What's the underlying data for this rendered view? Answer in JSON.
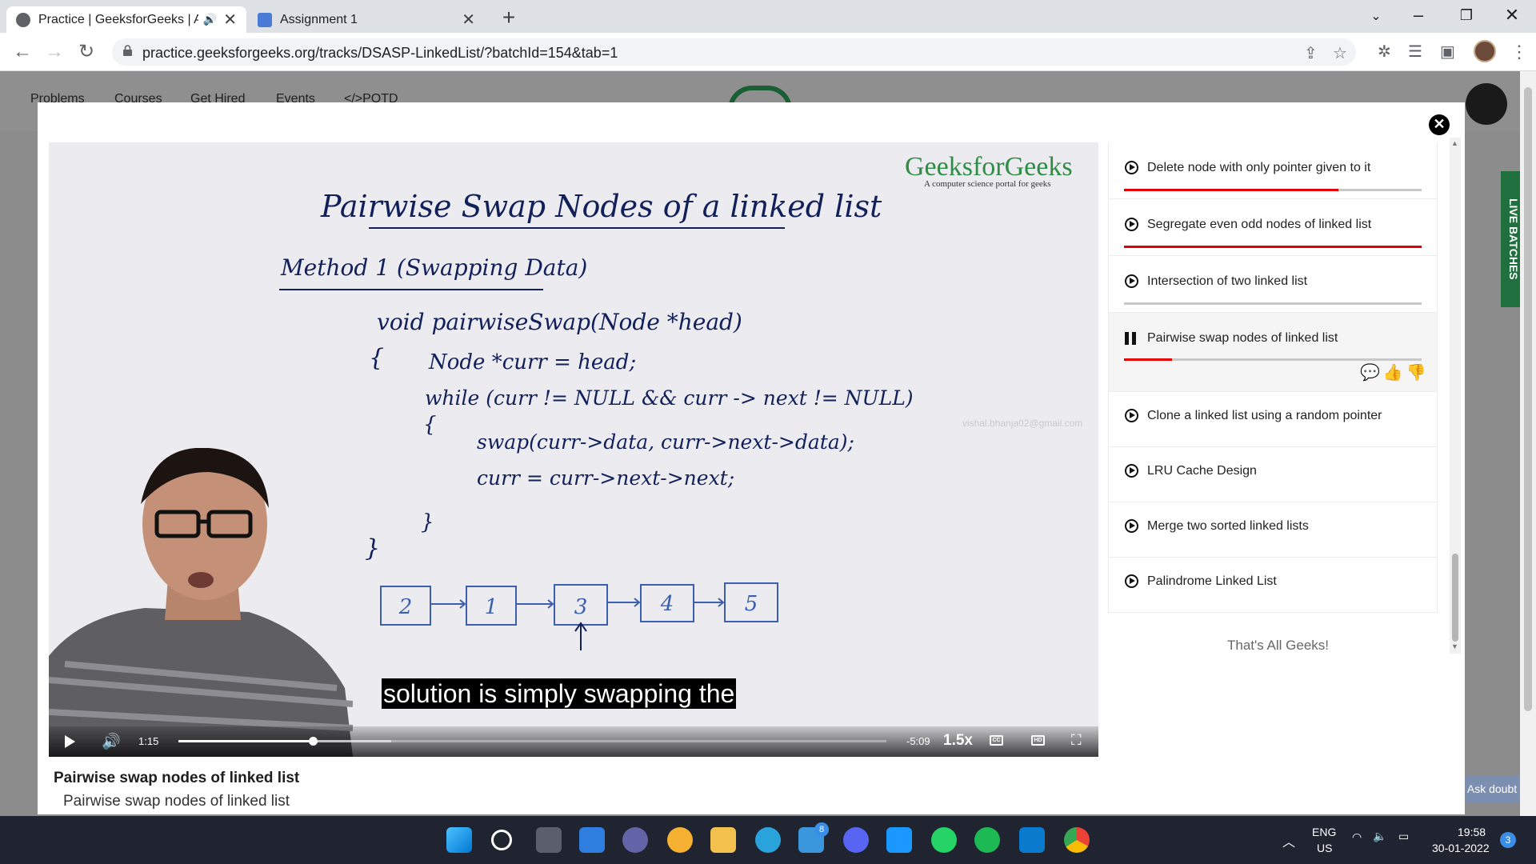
{
  "browser": {
    "tabs": [
      {
        "title": "Practice | GeeksforGeeks | A"
      },
      {
        "title": "Assignment 1"
      }
    ],
    "url": "practice.geeksforgeeks.org/tracks/DSASP-LinkedList/?batchId=154&tab=1"
  },
  "site": {
    "nav": [
      "Problems",
      "Courses",
      "Get Hired",
      "Events",
      "</>POTD"
    ],
    "live_batches": "LIVE BATCHES",
    "ask_doubt": "Ask doubt"
  },
  "video": {
    "brand": "GeeksforGeeks",
    "tagline": "A computer science portal for geeks",
    "watermark_email": "vishal.bhanja02@gmail.com",
    "whiteboard": {
      "title": "Pairwise Swap Nodes of a linked list",
      "method": "Method 1 (Swapping Data)",
      "code": [
        "void  pairwiseSwap(Node  *head)",
        "{",
        "Node  *curr = head;",
        "while (curr != NULL && curr -> next != NULL)",
        "{",
        "swap(curr->data,   curr->next->data);",
        "curr  =  curr->next->next;",
        "}",
        "}"
      ],
      "list_nodes": [
        "2",
        "1",
        "3",
        "4",
        "5"
      ]
    },
    "caption": "solution is simply swapping the",
    "current_time": "1:15",
    "remaining_time": "-5:09",
    "speed": "1.5x",
    "progress": 0.19,
    "buffered": 0.3,
    "cc_label": "CC",
    "hd_label": "HD",
    "title": "Pairwise swap nodes of linked list",
    "subtitle": "Pairwise swap nodes of linked list"
  },
  "playlist": {
    "items": [
      {
        "label": "Delete node with only pointer given to it",
        "progress": 0.72,
        "state": "play"
      },
      {
        "label": "Segregate even odd nodes of linked list",
        "progress": 1.0,
        "state": "play"
      },
      {
        "label": "Intersection of two linked list",
        "progress": 0.0,
        "state": "play"
      },
      {
        "label": "Pairwise swap nodes of linked list",
        "progress": 0.16,
        "state": "playing"
      },
      {
        "label": "Clone a linked list using a random pointer",
        "state": "play"
      },
      {
        "label": "LRU Cache Design",
        "state": "play"
      },
      {
        "label": "Merge two sorted linked lists",
        "state": "play"
      },
      {
        "label": "Palindrome Linked List",
        "state": "play"
      }
    ],
    "end_text": "That's All Geeks!"
  },
  "taskbar": {
    "language": "ENG",
    "region": "US",
    "time": "19:58",
    "date": "30-01-2022",
    "mail_badge": "8",
    "notifications": "3"
  },
  "colors": {
    "accent_red": "#e40000",
    "gfg_green": "#2f8d46",
    "marker_blue": "#12205a"
  }
}
